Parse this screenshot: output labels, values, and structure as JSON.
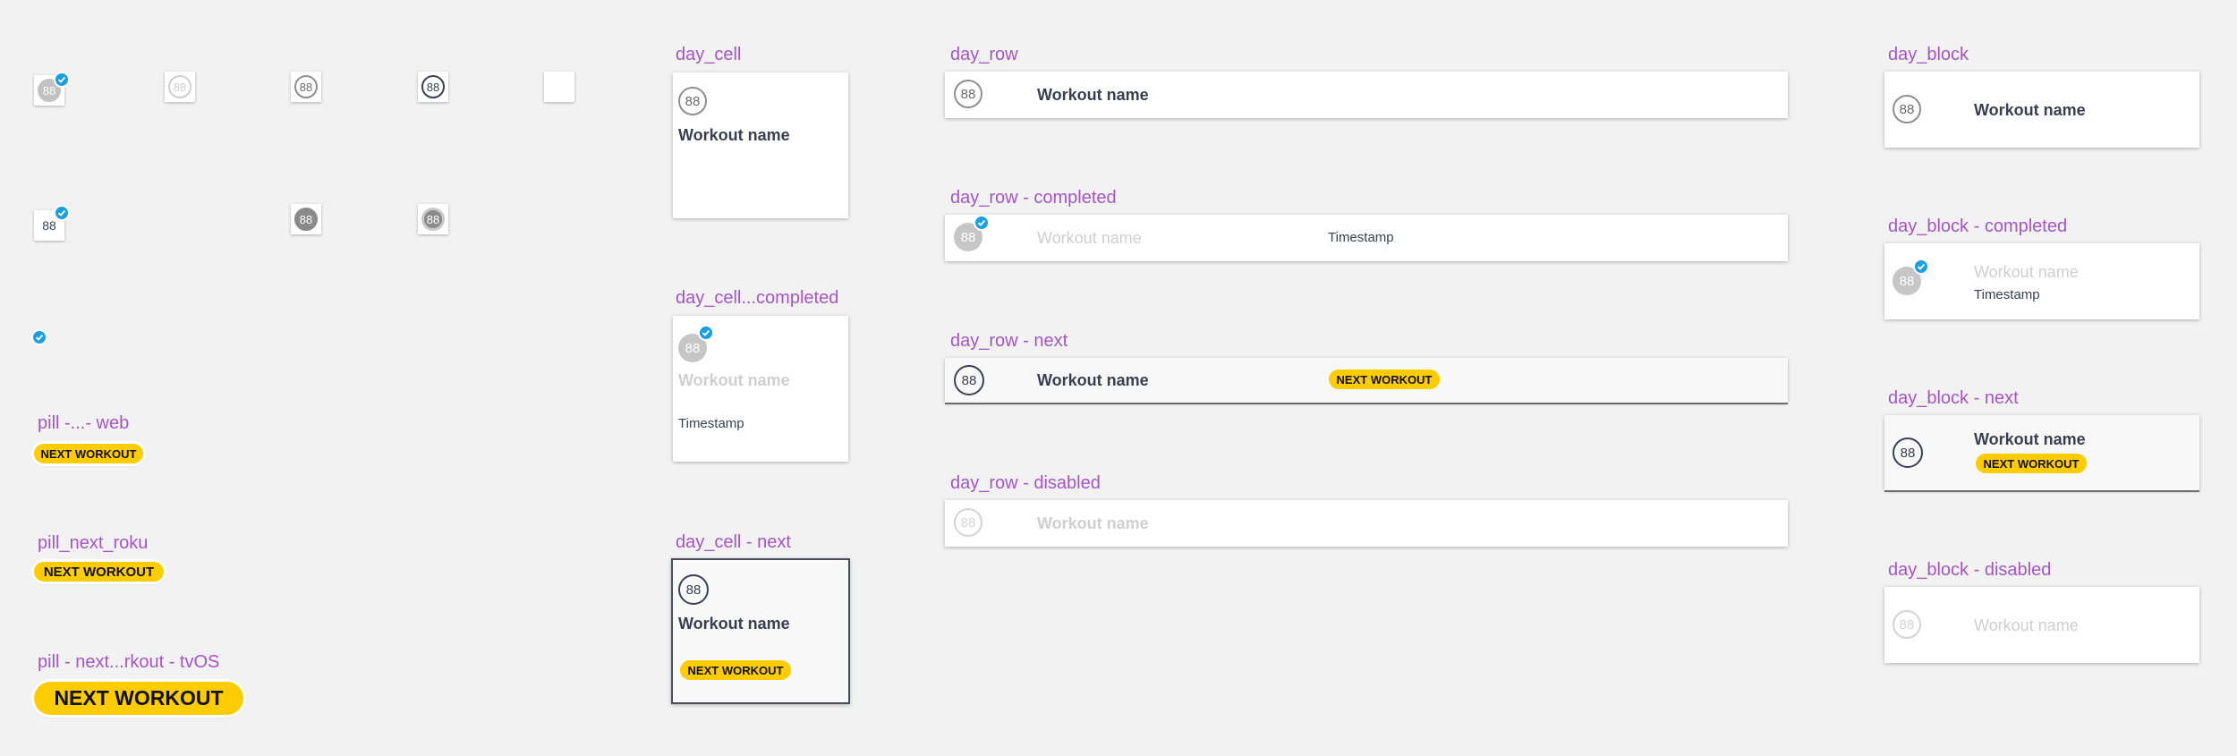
{
  "icons": {
    "day_number": "88"
  },
  "labels": {
    "day_cell": "day_cell",
    "day_cell_completed": "day_cell...completed",
    "day_cell_next": "day_cell - next",
    "day_row": "day_row",
    "day_row_completed": "day_row - completed",
    "day_row_next": "day_row - next",
    "day_row_disabled": "day_row - disabled",
    "day_block": "day_block",
    "day_block_completed": "day_block - completed",
    "day_block_next": "day_block - next",
    "day_block_disabled": "day_block - disabled",
    "pill_web": "pill -...- web",
    "pill_roku": "pill_next_roku",
    "pill_tvos": "pill - next...rkout - tvOS"
  },
  "pill_text": "NEXT WORKOUT",
  "workout_name": "Workout name",
  "timestamp": "Timestamp",
  "colors": {
    "background": "#f2f2f2",
    "label_purple": "#a455c6",
    "pill_yellow": "#ffcc00",
    "check_blue": "#1a9fe0",
    "text_dark": "#3a3f4f",
    "faded_text": "#cfcfcf"
  }
}
